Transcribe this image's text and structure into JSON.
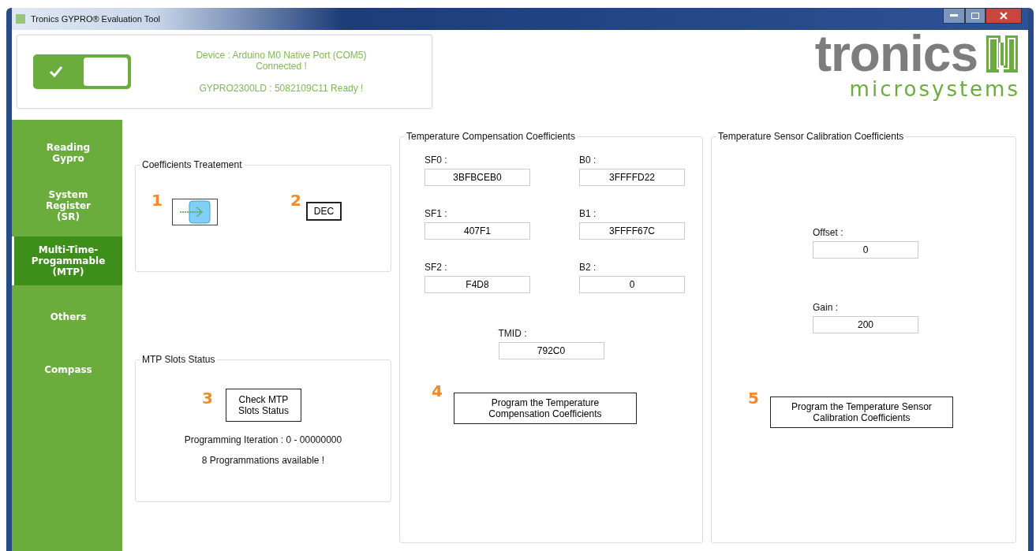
{
  "window": {
    "title": "Tronics GYPRO® Evaluation Tool"
  },
  "status": {
    "connected": true,
    "device_line": "Device : Arduino M0 Native Port (COM5)",
    "connected_line": "Connected !",
    "chip_line": "GYPRO2300LD : 5082109C11 Ready !"
  },
  "logo": {
    "name": "tronics",
    "tagline": "microsystems"
  },
  "sidebar": {
    "items": [
      {
        "label": "Reading Gypro",
        "selected": false
      },
      {
        "label": "System Register (SR)",
        "selected": false
      },
      {
        "label": "Multi-Time-Progammable (MTP)",
        "selected": true
      },
      {
        "label": "Others",
        "selected": false
      },
      {
        "label": "Compass",
        "selected": false
      }
    ]
  },
  "coefficients_treatment": {
    "title": "Coefficients Treatement",
    "step": "1",
    "format_step": "2",
    "format_button": "DEC"
  },
  "mtp_slots": {
    "title": "MTP Slots Status",
    "step": "3",
    "button": "Check MTP Slots Status",
    "iteration": "Programming Iteration : 0 - 00000000",
    "available": "8 Programmations available !"
  },
  "temperature_compensation": {
    "title": "Temperature Compensation Coefficients",
    "fields": [
      {
        "label": "SF0 :",
        "value": "3BFBCEB0"
      },
      {
        "label": "B0 :",
        "value": "3FFFFD22"
      },
      {
        "label": "SF1 :",
        "value": "407F1"
      },
      {
        "label": "B1 :",
        "value": "3FFFF67C"
      },
      {
        "label": "SF2 :",
        "value": "F4D8"
      },
      {
        "label": "B2 :",
        "value": "0"
      }
    ],
    "tmid": {
      "label": "TMID :",
      "value": "792C0"
    },
    "step": "4",
    "button": "Program the Temperature Compensation Coefficients"
  },
  "sensor_calibration": {
    "title": "Temperature Sensor Calibration Coefficients",
    "fields": [
      {
        "label": "Offset :",
        "value": "0"
      },
      {
        "label": "Gain :",
        "value": "200"
      }
    ],
    "step": "5",
    "button": "Program the Temperature Sensor Calibration Coefficients"
  }
}
